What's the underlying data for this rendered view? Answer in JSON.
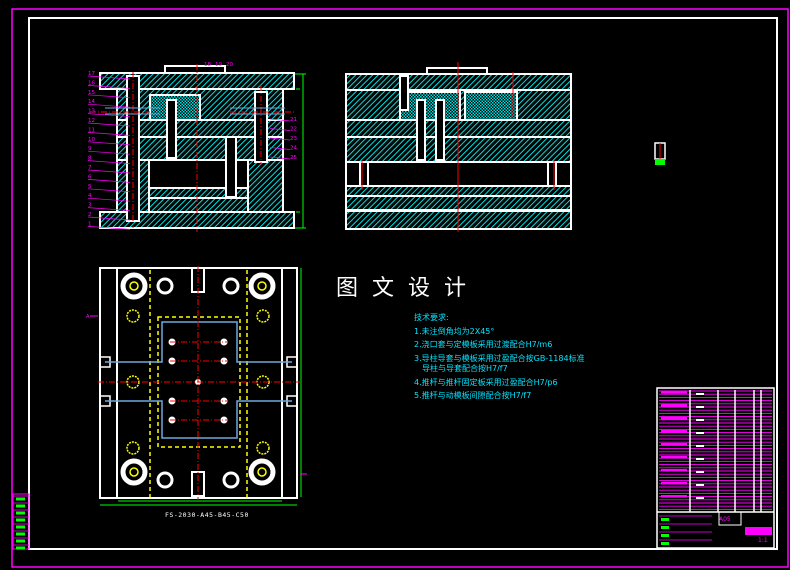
{
  "drawing": {
    "title": "图文设计",
    "model_code": "FS-2030-A45-B45-C50",
    "section_mark": "A",
    "part_numbers_left": [
      "17",
      "16",
      "15",
      "14",
      "13",
      "12",
      "11",
      "10",
      "9",
      "8",
      "7",
      "6",
      "5",
      "4",
      "3",
      "2",
      "1"
    ],
    "part_numbers_top": [
      "18",
      "19",
      "20"
    ],
    "part_numbers_right": [
      "21",
      "22",
      "23",
      "24",
      "25"
    ],
    "title_block_name": "A05",
    "title_block_scale": "1:1"
  },
  "tech_requirements": {
    "heading": "技术要求:",
    "items": [
      "1.未注倒角均为2X45°",
      "2.浇口套与定模板采用过渡配合H7/m6",
      "3.导柱导套与模板采用过盈配合按GB-1184标准",
      "导柱与导套配合按H7/f7",
      "4.推杆与推杆固定板采用过盈配合H7/p6",
      "5.推杆与动模板间隙配合按H7/f7"
    ]
  },
  "colors": {
    "border_outer": "#ff00ff",
    "border_inner": "#ffffff",
    "hatch": "#00e5e5",
    "centerline": "#ff0000",
    "dimension": "#00ff00",
    "leader": "#ff00ff",
    "cooling": "#6fa8dc",
    "guide_outline": "#ffff00"
  }
}
